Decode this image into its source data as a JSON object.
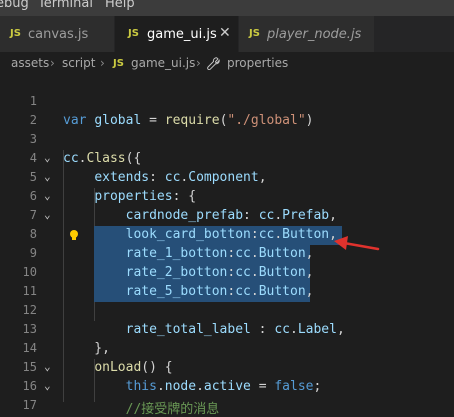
{
  "menu": {
    "items": [
      "ebug",
      "Terminal",
      "Help"
    ]
  },
  "tabs": [
    {
      "icon": "JS",
      "label": "canvas.js",
      "active": false,
      "italic": false
    },
    {
      "icon": "JS",
      "label": "game_ui.js",
      "active": true,
      "italic": false,
      "close": "✕"
    },
    {
      "icon": "JS",
      "label": "player_node.js",
      "active": false,
      "italic": true
    }
  ],
  "breadcrumb": {
    "seg1": "assets",
    "seg2": "script",
    "file_icon": "JS",
    "file": "game_ui.js",
    "symbol_icon": "wrench-icon",
    "symbol": "properties"
  },
  "editor": {
    "line_numbers": [
      "1",
      "2",
      "3",
      "4",
      "5",
      "6",
      "7",
      "8",
      "9",
      "10",
      "11",
      "12",
      "13",
      "14",
      "15",
      "16",
      "17"
    ],
    "lines": [
      [],
      [
        [
          "k",
          "var "
        ],
        [
          "v",
          "global"
        ],
        [
          "p",
          " = "
        ],
        [
          "fn",
          "require"
        ],
        [
          "p",
          "("
        ],
        [
          "s",
          "\"./global\""
        ],
        [
          "p",
          ")"
        ]
      ],
      [],
      [
        [
          "v",
          "cc"
        ],
        [
          "p",
          "."
        ],
        [
          "fn",
          "Class"
        ],
        [
          "p",
          "({"
        ]
      ],
      [
        [
          "p",
          "    "
        ],
        [
          "v",
          "extends"
        ],
        [
          "p",
          ": "
        ],
        [
          "v",
          "cc"
        ],
        [
          "p",
          "."
        ],
        [
          "v",
          "Component"
        ],
        [
          "p",
          ","
        ]
      ],
      [
        [
          "p",
          "    "
        ],
        [
          "v",
          "properties"
        ],
        [
          "p",
          ": {"
        ]
      ],
      [
        [
          "p",
          "        "
        ],
        [
          "v",
          "cardnode_prefab"
        ],
        [
          "p",
          ": "
        ],
        [
          "v",
          "cc"
        ],
        [
          "p",
          "."
        ],
        [
          "v",
          "Prefab"
        ],
        [
          "p",
          ","
        ]
      ],
      [
        [
          "p",
          "        "
        ],
        [
          "v",
          "look_card_botton"
        ],
        [
          "p",
          ":"
        ],
        [
          "v",
          "cc"
        ],
        [
          "p",
          "."
        ],
        [
          "v",
          "Button"
        ],
        [
          "p",
          ","
        ]
      ],
      [
        [
          "p",
          "        "
        ],
        [
          "v",
          "rate_1_botton"
        ],
        [
          "p",
          ":"
        ],
        [
          "v",
          "cc"
        ],
        [
          "p",
          "."
        ],
        [
          "v",
          "Button"
        ],
        [
          "p",
          ","
        ]
      ],
      [
        [
          "p",
          "        "
        ],
        [
          "v",
          "rate_2_botton"
        ],
        [
          "p",
          ":"
        ],
        [
          "v",
          "cc"
        ],
        [
          "p",
          "."
        ],
        [
          "v",
          "Button"
        ],
        [
          "p",
          ","
        ]
      ],
      [
        [
          "p",
          "        "
        ],
        [
          "v",
          "rate_5_botton"
        ],
        [
          "p",
          ":"
        ],
        [
          "v",
          "cc"
        ],
        [
          "p",
          "."
        ],
        [
          "v",
          "Button"
        ],
        [
          "p",
          ","
        ]
      ],
      [],
      [
        [
          "p",
          "        "
        ],
        [
          "v",
          "rate_total_label"
        ],
        [
          "p",
          " : "
        ],
        [
          "v",
          "cc"
        ],
        [
          "p",
          "."
        ],
        [
          "v",
          "Label"
        ],
        [
          "p",
          ","
        ]
      ],
      [
        [
          "p",
          "    },"
        ]
      ],
      [
        [
          "p",
          "    "
        ],
        [
          "fn",
          "onLoad"
        ],
        [
          "p",
          "() {"
        ]
      ],
      [
        [
          "p",
          "        "
        ],
        [
          "k",
          "this"
        ],
        [
          "p",
          "."
        ],
        [
          "v",
          "node"
        ],
        [
          "p",
          "."
        ],
        [
          "v",
          "active"
        ],
        [
          "p",
          " = "
        ],
        [
          "k",
          "false"
        ],
        [
          "p",
          ";"
        ]
      ],
      [
        [
          "p",
          "        "
        ],
        [
          "c",
          "//接受牌的消息"
        ]
      ]
    ]
  },
  "colors": {
    "selection": "#264f78",
    "annotation_arrow": "#e0322d",
    "lightbulb": "#ffcc00"
  }
}
